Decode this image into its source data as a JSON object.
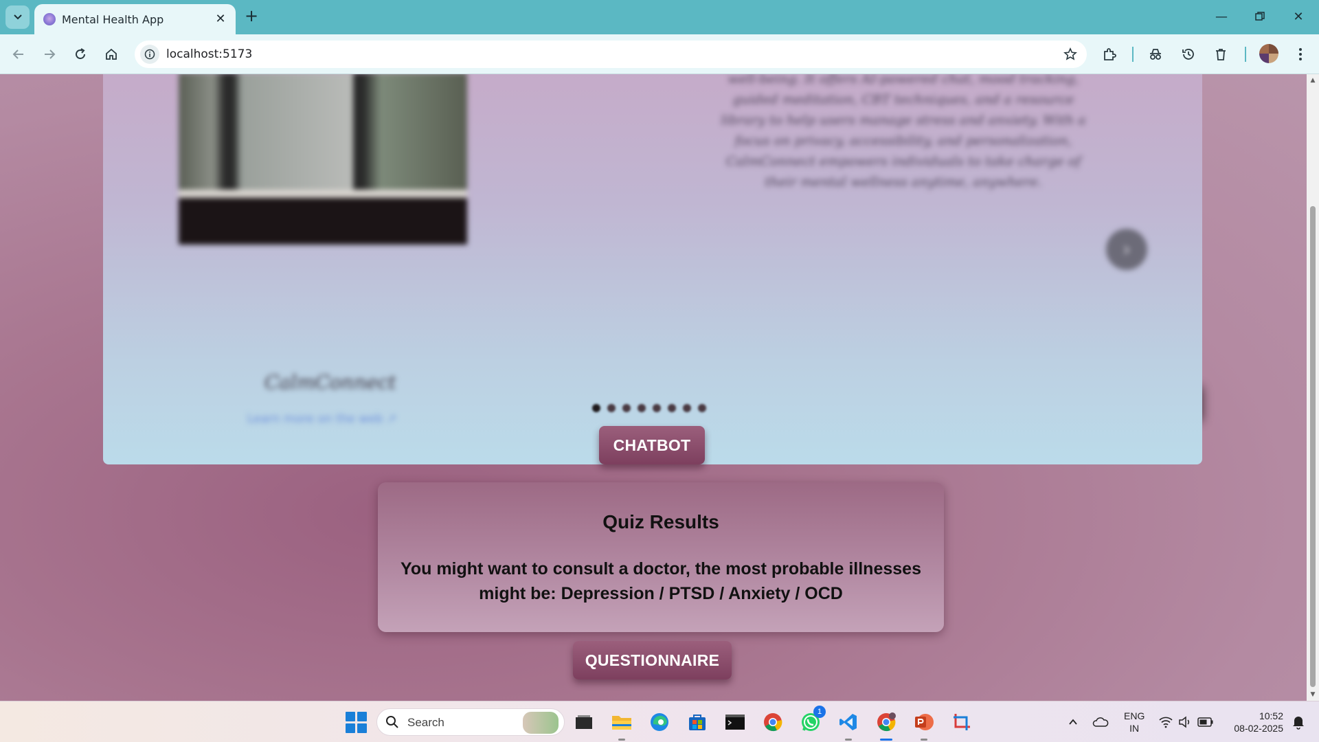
{
  "browser": {
    "tab_title": "Mental Health App",
    "url": "localhost:5173",
    "icons": [
      "tab-search-icon",
      "close-icon",
      "plus-icon",
      "minimize-icon",
      "restore-icon",
      "close-window-icon",
      "back-icon",
      "forward-icon",
      "reload-icon",
      "home-icon",
      "info-icon",
      "star-icon",
      "extensions-icon",
      "incognito-icon",
      "history-icon",
      "trash-icon",
      "profile-avatar",
      "menu-icon"
    ]
  },
  "carousel": {
    "description": "well-being. It offers AI-powered chat, mood tracking, guided meditation, CBT techniques, and a resource library to help users manage stress and anxiety. With a focus on privacy, accessibility, and personalization, CalmConnect empowers individuals to take charge of their mental wellness anytime, anywhere.",
    "title": "CalmConnect",
    "link": "Learn more on the web",
    "dot_count": 8,
    "active_dot": 0
  },
  "buttons": {
    "chatbot": "CHATBOT",
    "questionnaire": "QUESTIONNAIRE"
  },
  "quiz": {
    "title": "Quiz Results",
    "message": "You might want to consult a doctor, the most probable illnesses might be: Depression / PTSD / Anxiety / OCD"
  },
  "taskbar": {
    "search_placeholder": "Search",
    "whatsapp_badge": "1",
    "lang_line1": "ENG",
    "lang_line2": "IN",
    "time": "10:52",
    "date": "08-02-2025"
  },
  "colors": {
    "tabstrip": "#5bb8c3",
    "button_primary": "#8a4c6b",
    "page_background": "#ae7f97"
  }
}
